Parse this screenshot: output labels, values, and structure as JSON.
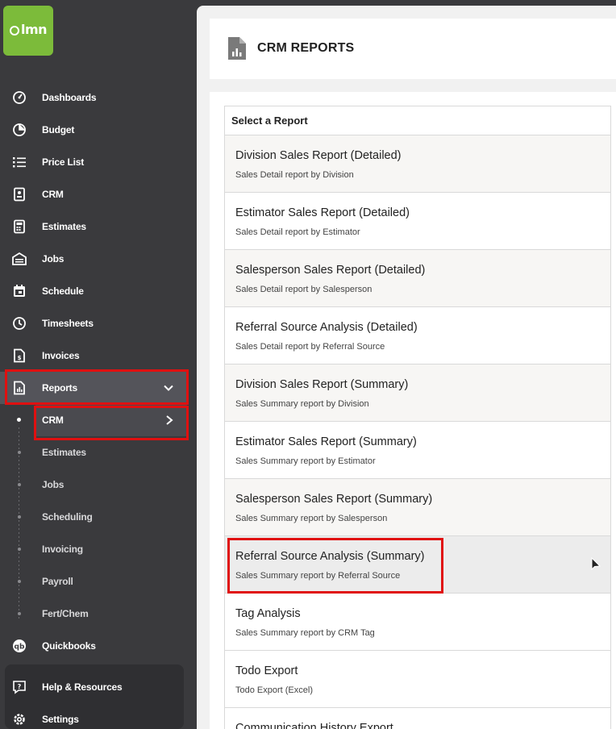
{
  "brand": {
    "logo_text": "lmn",
    "color": "#7cbb3a"
  },
  "sidebar": {
    "items": [
      {
        "label": "Dashboards",
        "icon": "gauge-icon"
      },
      {
        "label": "Budget",
        "icon": "pie-chart-icon"
      },
      {
        "label": "Price List",
        "icon": "list-icon"
      },
      {
        "label": "CRM",
        "icon": "contact-card-icon"
      },
      {
        "label": "Estimates",
        "icon": "calculator-icon"
      },
      {
        "label": "Jobs",
        "icon": "garage-icon"
      },
      {
        "label": "Schedule",
        "icon": "calendar-icon"
      },
      {
        "label": "Timesheets",
        "icon": "clock-icon"
      },
      {
        "label": "Invoices",
        "icon": "invoice-icon"
      },
      {
        "label": "Reports",
        "icon": "report-icon"
      }
    ],
    "report_subitems": [
      "CRM",
      "Estimates",
      "Jobs",
      "Scheduling",
      "Invoicing",
      "Payroll",
      "Fert/Chem"
    ],
    "quickbooks": "Quickbooks",
    "help": "Help & Resources",
    "settings": "Settings"
  },
  "header": {
    "title": "CRM REPORTS"
  },
  "report_list": {
    "heading": "Select a Report",
    "rows": [
      {
        "title": "Division Sales Report (Detailed)",
        "subtitle": "Sales Detail report by Division"
      },
      {
        "title": "Estimator Sales Report (Detailed)",
        "subtitle": "Sales Detail report by Estimator"
      },
      {
        "title": "Salesperson Sales Report (Detailed)",
        "subtitle": "Sales Detail report by Salesperson"
      },
      {
        "title": "Referral Source Analysis (Detailed)",
        "subtitle": "Sales Detail report by Referral Source"
      },
      {
        "title": "Division Sales Report (Summary)",
        "subtitle": "Sales Summary report by Division"
      },
      {
        "title": "Estimator Sales Report (Summary)",
        "subtitle": "Sales Summary report by Estimator"
      },
      {
        "title": "Salesperson Sales Report (Summary)",
        "subtitle": "Sales Summary report by Salesperson"
      },
      {
        "title": "Referral Source Analysis (Summary)",
        "subtitle": "Sales Summary report by Referral Source"
      },
      {
        "title": "Tag Analysis",
        "subtitle": "Sales Summary report by CRM Tag"
      },
      {
        "title": "Todo Export",
        "subtitle": "Todo Export (Excel)"
      },
      {
        "title": "Communication History Export",
        "subtitle": ""
      }
    ]
  },
  "colors": {
    "highlight": "#e01010",
    "sidebar_bg": "#3a3a3d"
  }
}
